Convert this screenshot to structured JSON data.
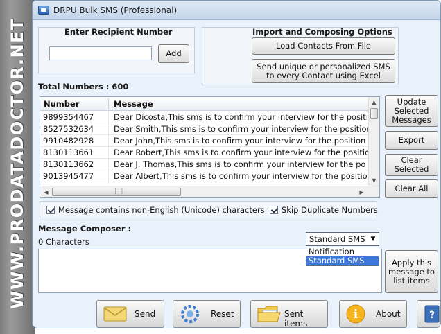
{
  "banner": {
    "text": "WWW.PRODATADOCTOR.NET"
  },
  "window": {
    "title": "DRPU Bulk SMS (Professional)"
  },
  "recipient": {
    "label": "Enter Recipient Number",
    "input_value": "",
    "add_label": "Add"
  },
  "import": {
    "label": "Import and Composing Options",
    "load_contacts_label": "Load Contacts From File",
    "send_unique_line1": "Send unique or personalized SMS",
    "send_unique_line2": "to every Contact using Excel"
  },
  "total": {
    "label": "Total Numbers :",
    "value": "600"
  },
  "table": {
    "columns": [
      "Number",
      "Message"
    ],
    "rows": [
      {
        "number": "9899354467",
        "message": "Dear Dicosta,This sms is to confirm your interview for the positi"
      },
      {
        "number": "8527532634",
        "message": "Dear Smith,This sms is to confirm your interview for the position"
      },
      {
        "number": "9910482928",
        "message": "Dear John,This sms is to confirm your interview for the position"
      },
      {
        "number": "8130113661",
        "message": "Dear Robert,This sms is to confirm your interview for the positio"
      },
      {
        "number": "8130113662",
        "message": "Dear J. Thomas,This sms is to confirm your interview for the po"
      },
      {
        "number": "9013945477",
        "message": "Dear Albert,This sms is to confirm your interview for the positio"
      }
    ]
  },
  "side_buttons": {
    "update_line1": "Update",
    "update_line2": "Selected",
    "update_line3": "Messages",
    "export": "Export",
    "clear_selected_line1": "Clear",
    "clear_selected_line2": "Selected",
    "clear_all": "Clear All"
  },
  "options": {
    "unicode_label": "Message contains non-English (Unicode) characters",
    "unicode_checked": true,
    "skip_dup_label": "Skip Duplicate Numbers",
    "skip_dup_checked": true
  },
  "composer": {
    "label": "Message Composer :",
    "char_count": "0 Characters",
    "text": "",
    "sms_type_selected": "Standard SMS",
    "sms_type_options": [
      "Notification",
      "Standard SMS"
    ],
    "apply_line1": "Apply this",
    "apply_line2": "message to",
    "apply_line3": "list items"
  },
  "bottom": {
    "send": "Send",
    "reset": "Reset",
    "sent_items": "Sent items",
    "about": "About"
  }
}
